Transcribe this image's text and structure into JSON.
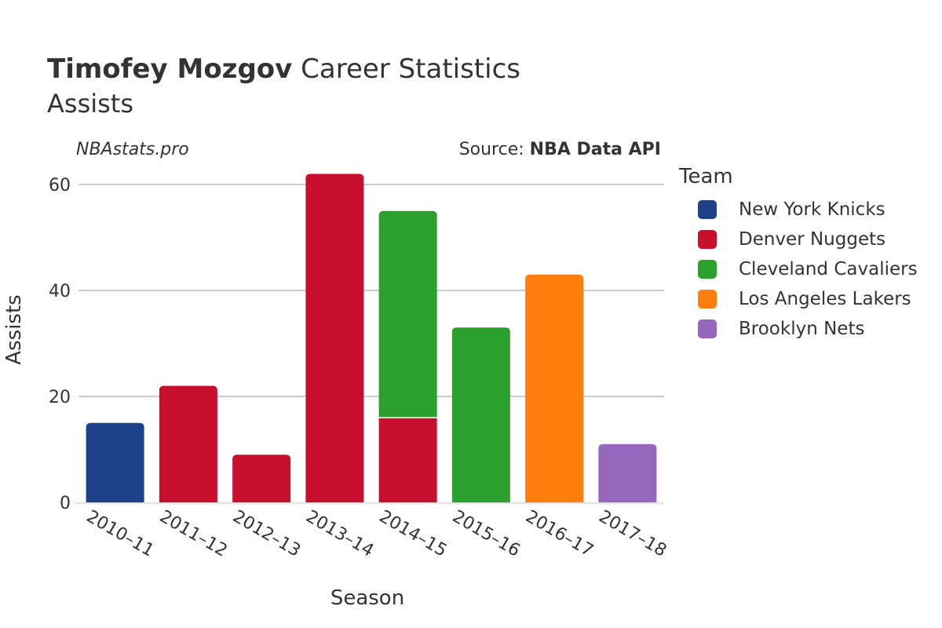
{
  "header": {
    "player_name": "Timofey Mozgov",
    "title_suffix": " Career Statistics",
    "subtitle": "Assists",
    "brand": "NBAstats.pro",
    "source_prefix": "Source: ",
    "source_name": "NBA Data API"
  },
  "legend": {
    "title": "Team",
    "items": [
      {
        "label": "New York Knicks",
        "color": "#1d428a"
      },
      {
        "label": "Denver Nuggets",
        "color": "#c8102e"
      },
      {
        "label": "Cleveland Cavaliers",
        "color": "#2ca02c"
      },
      {
        "label": "Los Angeles Lakers",
        "color": "#ff7f0e"
      },
      {
        "label": "Brooklyn Nets",
        "color": "#9467bd"
      }
    ]
  },
  "chart_data": {
    "type": "bar",
    "stacked": true,
    "title": "Timofey Mozgov Career Statistics",
    "subtitle": "Assists",
    "xlabel": "Season",
    "ylabel": "Assists",
    "ylim": [
      0,
      65
    ],
    "yticks": [
      0,
      20,
      40,
      60
    ],
    "grid": true,
    "legend_position": "right",
    "categories": [
      "2010–11",
      "2011–12",
      "2012–13",
      "2013–14",
      "2014–15",
      "2015–16",
      "2016–17",
      "2017–18"
    ],
    "series": [
      {
        "name": "New York Knicks",
        "color": "#1d428a",
        "values": [
          15,
          0,
          0,
          0,
          0,
          0,
          0,
          0
        ]
      },
      {
        "name": "Denver Nuggets",
        "color": "#c8102e",
        "values": [
          0,
          22,
          9,
          62,
          16,
          0,
          0,
          0
        ]
      },
      {
        "name": "Cleveland Cavaliers",
        "color": "#2ca02c",
        "values": [
          0,
          0,
          0,
          0,
          39,
          33,
          0,
          0
        ]
      },
      {
        "name": "Los Angeles Lakers",
        "color": "#ff7f0e",
        "values": [
          0,
          0,
          0,
          0,
          0,
          0,
          43,
          0
        ]
      },
      {
        "name": "Brooklyn Nets",
        "color": "#9467bd",
        "values": [
          0,
          0,
          0,
          0,
          0,
          0,
          0,
          11
        ]
      }
    ]
  }
}
